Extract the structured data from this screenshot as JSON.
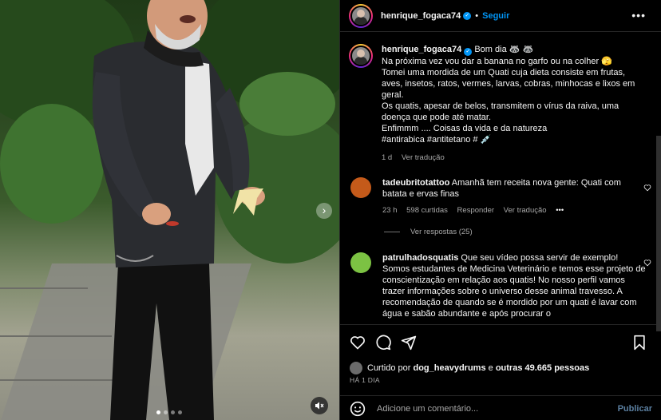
{
  "post": {
    "author": "henrique_fogaca74",
    "follow_label": "Seguir",
    "separator": "•",
    "caption": {
      "greeting": "Bom dia 🦝 🦝",
      "lines": [
        "Na próxima vez vou dar a banana no garfo ou na colher 🫣",
        "Tomei uma mordida de um Quati cuja dieta consiste em frutas, aves, insetos, ratos, vermes, larvas, cobras, minhocas e lixos em geral.",
        "Os quatis, apesar de belos, transmitem o vírus da raiva, uma doença que pode até matar.",
        "Enfimmm .... Coisas da vida e da natureza",
        "#antirabica #antitetano # 💉"
      ],
      "time": "1 d",
      "translate": "Ver tradução"
    }
  },
  "comments": [
    {
      "user": "tadeubritotattoo",
      "text": "Amanhã tem receita nova gente: Quati com batata e ervas finas",
      "time": "23 h",
      "likes": "598 curtidas",
      "reply": "Responder",
      "translate": "Ver tradução",
      "more": "•••",
      "view_replies": "Ver respostas (25)",
      "avatar_color": "#c45a1a"
    },
    {
      "user": "patrulhadosquatis",
      "text": "Que seu vídeo possa servir de exemplo! Somos estudantes de Medicina Veterinário e temos esse projeto de conscientização em relação aos quatis! No nosso perfil vamos trazer informações sobre o universo desse animal travesso. A recomendação de quando se é mordido por um quati é lavar com água e sabão abundante e após procurar o",
      "avatar_color": "#7cc243"
    }
  ],
  "footer": {
    "liked_prefix": "Curtido por",
    "liked_user": "dog_heavydrums",
    "liked_connector": "e",
    "liked_others": "outras 49.665 pessoas",
    "date": "HÁ 1 DIA",
    "comment_placeholder": "Adicione um comentário...",
    "publish": "Publicar"
  },
  "icons": {
    "header_more": "more-horizontal-icon",
    "like": "heart-icon",
    "comment": "comment-bubble-icon",
    "share": "send-icon",
    "save": "bookmark-icon",
    "emoji": "emoji-icon",
    "mute": "muted-speaker-icon",
    "next": "chevron-right-icon"
  },
  "colors": {
    "accent": "#0095f6",
    "muted": "#a8a8a8",
    "border": "#262626"
  }
}
